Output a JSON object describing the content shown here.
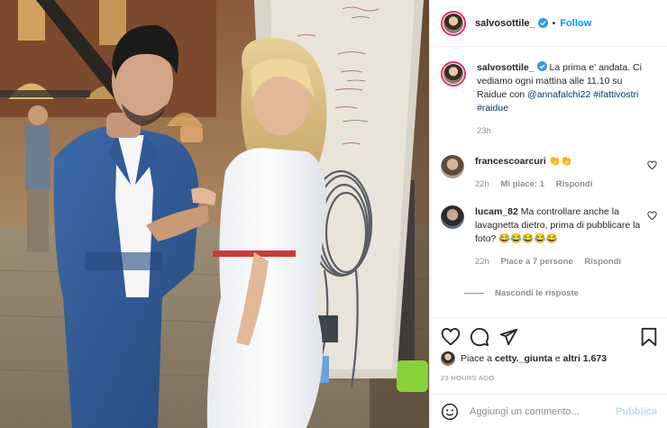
{
  "header": {
    "username": "salvosottile_",
    "separator": "•",
    "follow_label": "Follow"
  },
  "caption": {
    "username": "salvosottile_",
    "text": "La prima e' andata. Ci vediamo ogni mattina alle 11.10 su Raidue con",
    "mention": "@annafalchi22",
    "hashtag1": "#ifattivostri",
    "hashtag2": "#raidue",
    "age": "23h"
  },
  "comments": [
    {
      "username": "francescoarcuri",
      "text": "👏👏",
      "age": "22h",
      "likes_label": "Mi piace: 1",
      "reply_label": "Rispondi"
    },
    {
      "username": "lucam_82",
      "text": "Ma controllare anche la lavagnetta dietro, prima di pubblicare la foto? 😂😂😂😂😂",
      "age": "22h",
      "likes_label": "Piace a 7 persone",
      "reply_label": "Rispondi"
    }
  ],
  "hide_replies_label": "Nascondi le risposte",
  "likes": {
    "prefix": "Piace a ",
    "user": "cetty._giunta",
    "middle": " e ",
    "others": "altri 1.673"
  },
  "timestamp": "23 HOURS AGO",
  "add_comment": {
    "placeholder": "Aggiungi un commento...",
    "publish_label": "Pubblica"
  },
  "colors": {
    "follow_blue": "#0095f6",
    "publish_disabled": "#b2dffc",
    "meta_gray": "#8e8e8e"
  },
  "icons": [
    "verified-badge-icon",
    "heart-icon",
    "comment-icon",
    "share-icon",
    "bookmark-icon",
    "emoji-icon"
  ]
}
